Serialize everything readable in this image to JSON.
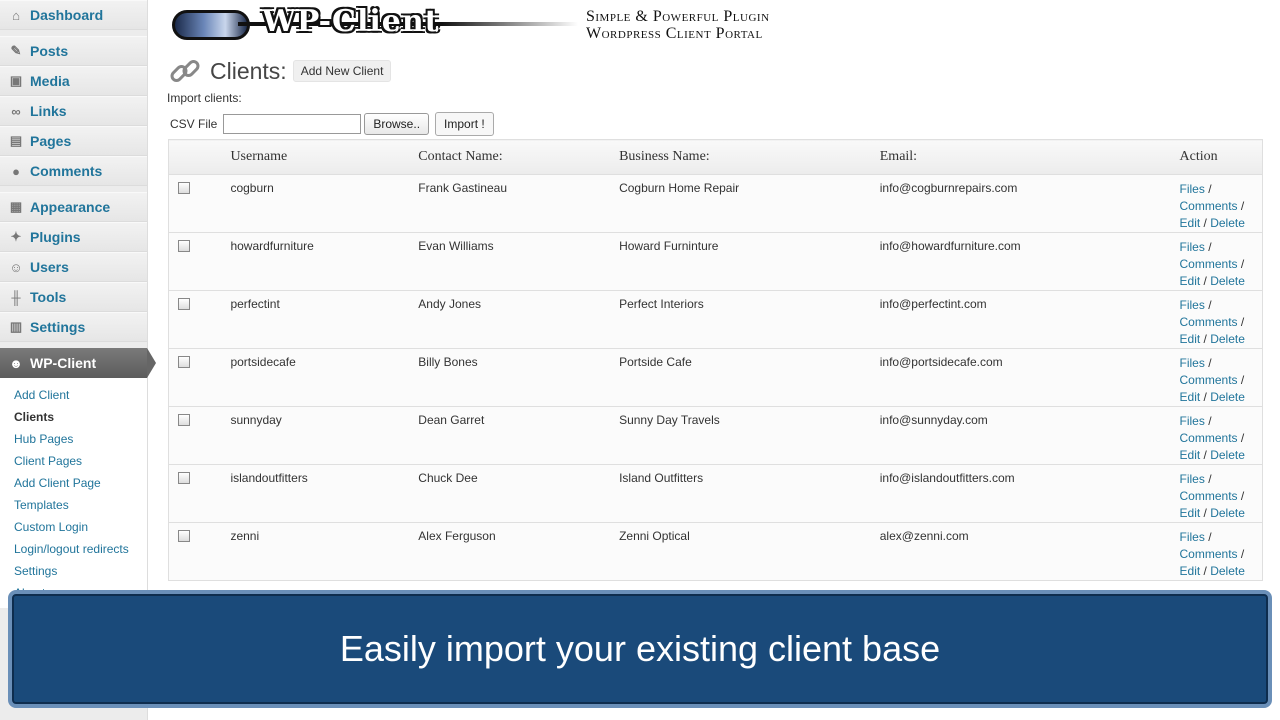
{
  "sidebar": {
    "items": [
      {
        "label": "Dashboard",
        "icon": "dashboard-icon",
        "glyph": "⌂"
      },
      {
        "label": "Posts",
        "icon": "pushpin-icon",
        "glyph": "✎"
      },
      {
        "label": "Media",
        "icon": "media-icon",
        "glyph": "▣"
      },
      {
        "label": "Links",
        "icon": "link-icon",
        "glyph": "∞"
      },
      {
        "label": "Pages",
        "icon": "pages-icon",
        "glyph": "▤"
      },
      {
        "label": "Comments",
        "icon": "comment-bubble-icon",
        "glyph": "●"
      },
      {
        "label": "Appearance",
        "icon": "appearance-icon",
        "glyph": "▦"
      },
      {
        "label": "Plugins",
        "icon": "plug-icon",
        "glyph": "✦"
      },
      {
        "label": "Users",
        "icon": "users-icon",
        "glyph": "☺"
      },
      {
        "label": "Tools",
        "icon": "tools-icon",
        "glyph": "╫"
      },
      {
        "label": "Settings",
        "icon": "settings-icon",
        "glyph": "▥"
      }
    ],
    "active": {
      "label": "WP-Client",
      "icon": "wp-client-icon",
      "glyph": "☻"
    },
    "submenu": [
      "Add Client",
      "Clients",
      "Hub Pages",
      "Client Pages",
      "Add Client Page",
      "Templates",
      "Custom Login",
      "Login/logout redirects",
      "Settings",
      "About"
    ]
  },
  "banner": {
    "logo_text": "WP-Client",
    "tagline_line1": "Simple & Powerful Plugin",
    "tagline_line2": "Wordpress Client Portal"
  },
  "page": {
    "title": "Clients:",
    "add_new": "Add New Client",
    "import_label": "Import clients:",
    "csv_label": "CSV File",
    "browse": "Browse..",
    "import_button": "Import !"
  },
  "table": {
    "headers": [
      "Username",
      "Contact Name:",
      "Business Name:",
      "Email:",
      "Action"
    ],
    "rows": [
      {
        "username": "cogburn",
        "contact": "Frank Gastineau",
        "business": "Cogburn Home Repair",
        "email": "info@cogburnrepairs.com"
      },
      {
        "username": "howardfurniture",
        "contact": "Evan Williams",
        "business": "Howard Furninture",
        "email": "info@howardfurniture.com"
      },
      {
        "username": "perfectint",
        "contact": "Andy Jones",
        "business": "Perfect Interiors",
        "email": "info@perfectint.com"
      },
      {
        "username": "portsidecafe",
        "contact": "Billy Bones",
        "business": "Portside Cafe",
        "email": "info@portsidecafe.com"
      },
      {
        "username": "sunnyday",
        "contact": "Dean Garret",
        "business": "Sunny Day Travels",
        "email": "info@sunnyday.com"
      },
      {
        "username": "islandoutfitters",
        "contact": "Chuck Dee",
        "business": "Island Outfitters",
        "email": "info@islandoutfitters.com"
      },
      {
        "username": "zenni",
        "contact": "Alex Ferguson",
        "business": "Zenni Optical",
        "email": "alex@zenni.com"
      }
    ],
    "actions": {
      "files": "Files",
      "comments": "Comments",
      "edit": "Edit",
      "delete": "Delete",
      "sep": " /"
    }
  },
  "caption": "Easily import your existing client base",
  "colors": {
    "link": "#21759b",
    "caption_bg": "#1a4a7a"
  }
}
